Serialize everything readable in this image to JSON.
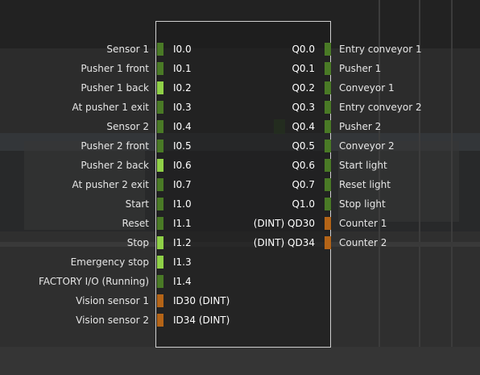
{
  "colors": {
    "bool_off": "#4a7a26",
    "bool_on": "#8fd047",
    "numeric": "#b46417",
    "panel_border": "#d0d0d0"
  },
  "inputs": [
    {
      "label": "Sensor 1",
      "address": "I0.0",
      "kind": "bool",
      "state": "off"
    },
    {
      "label": "Pusher 1 front",
      "address": "I0.1",
      "kind": "bool",
      "state": "off"
    },
    {
      "label": "Pusher 1 back",
      "address": "I0.2",
      "kind": "bool",
      "state": "on"
    },
    {
      "label": "At pusher 1 exit",
      "address": "I0.3",
      "kind": "bool",
      "state": "off"
    },
    {
      "label": "Sensor 2",
      "address": "I0.4",
      "kind": "bool",
      "state": "off"
    },
    {
      "label": "Pusher 2 front",
      "address": "I0.5",
      "kind": "bool",
      "state": "off"
    },
    {
      "label": "Pusher 2 back",
      "address": "I0.6",
      "kind": "bool",
      "state": "on"
    },
    {
      "label": "At pusher 2 exit",
      "address": "I0.7",
      "kind": "bool",
      "state": "off"
    },
    {
      "label": "Start",
      "address": "I1.0",
      "kind": "bool",
      "state": "off"
    },
    {
      "label": "Reset",
      "address": "I1.1",
      "kind": "bool",
      "state": "off"
    },
    {
      "label": "Stop",
      "address": "I1.2",
      "kind": "bool",
      "state": "on"
    },
    {
      "label": "Emergency stop",
      "address": "I1.3",
      "kind": "bool",
      "state": "on"
    },
    {
      "label": "FACTORY I/O (Running)",
      "address": "I1.4",
      "kind": "bool",
      "state": "off"
    },
    {
      "label": "Vision sensor 1",
      "address": "ID30 (DINT)",
      "kind": "numeric",
      "state": "off"
    },
    {
      "label": "Vision sensor 2",
      "address": "ID34 (DINT)",
      "kind": "numeric",
      "state": "off"
    }
  ],
  "outputs": [
    {
      "label": "Entry conveyor 1",
      "address": "Q0.0",
      "kind": "bool",
      "state": "off"
    },
    {
      "label": "Pusher 1",
      "address": "Q0.1",
      "kind": "bool",
      "state": "off"
    },
    {
      "label": "Conveyor 1",
      "address": "Q0.2",
      "kind": "bool",
      "state": "off"
    },
    {
      "label": "Entry conveyor 2",
      "address": "Q0.3",
      "kind": "bool",
      "state": "off"
    },
    {
      "label": "Pusher 2",
      "address": "Q0.4",
      "kind": "bool",
      "state": "off"
    },
    {
      "label": "Conveyor 2",
      "address": "Q0.5",
      "kind": "bool",
      "state": "off"
    },
    {
      "label": "Start light",
      "address": "Q0.6",
      "kind": "bool",
      "state": "off"
    },
    {
      "label": "Reset light",
      "address": "Q0.7",
      "kind": "bool",
      "state": "off"
    },
    {
      "label": "Stop light",
      "address": "Q1.0",
      "kind": "bool",
      "state": "off"
    },
    {
      "label": "Counter 1",
      "address": "(DINT) QD30",
      "kind": "numeric",
      "state": "off"
    },
    {
      "label": "Counter 2",
      "address": "(DINT) QD34",
      "kind": "numeric",
      "state": "off"
    }
  ]
}
